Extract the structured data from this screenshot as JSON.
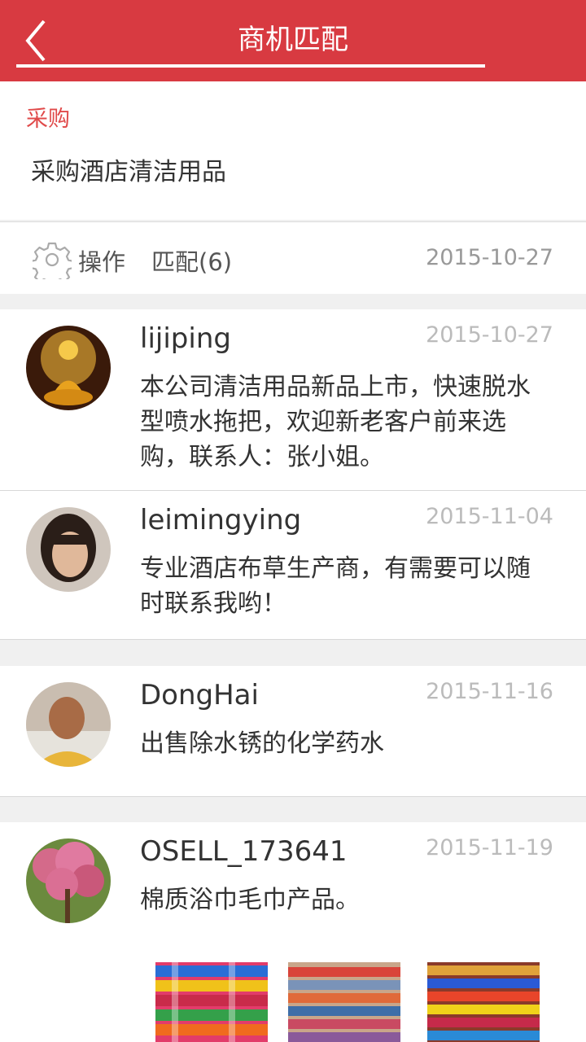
{
  "header": {
    "title": "商机匹配"
  },
  "request": {
    "tag": "采购",
    "description": "采购酒店清洁用品"
  },
  "ops": {
    "operate_label": "操作",
    "match_label": "匹配(6)",
    "date": "2015-10-27"
  },
  "matches": [
    {
      "name": "lijiping",
      "date": "2015-10-27",
      "message": "本公司清洁用品新品上市，快速脱水型喷水拖把，欢迎新老客户前来选购，联系人：张小姐。"
    },
    {
      "name": "leimingying",
      "date": "2015-11-04",
      "message": "专业酒店布草生产商，有需要可以随时联系我哟！"
    },
    {
      "name": "DongHai",
      "date": "2015-11-16",
      "message": "出售除水锈的化学药水"
    },
    {
      "name": "OSELL_173641",
      "date": "2015-11-19",
      "message": "棉质浴巾毛巾产品。"
    }
  ],
  "colors": {
    "brand": "#d83a41",
    "tag": "#e04a4a"
  }
}
